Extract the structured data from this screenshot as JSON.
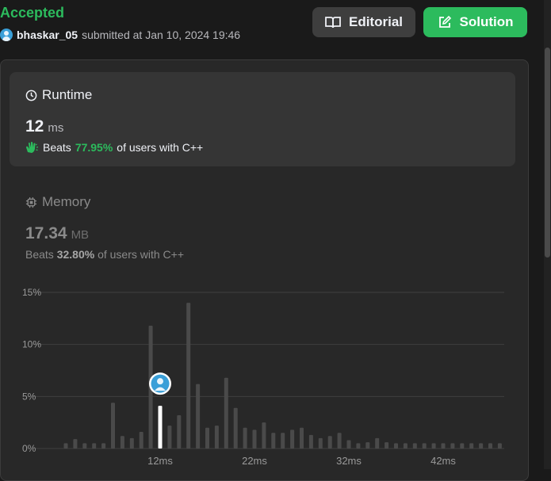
{
  "status": "Accepted",
  "submission": {
    "username": "bhaskar_05",
    "text": "submitted at Jan 10, 2024 19:46"
  },
  "buttons": {
    "editorial": "Editorial",
    "solution": "Solution"
  },
  "runtime": {
    "title": "Runtime",
    "value": "12",
    "unit": "ms",
    "beats_label": "Beats",
    "beats_percent": "77.95%",
    "beats_suffix": "of users with C++"
  },
  "memory": {
    "title": "Memory",
    "value": "17.34",
    "unit": "MB",
    "beats_label": "Beats",
    "beats_percent": "32.80%",
    "beats_suffix": "of users with C++"
  },
  "colors": {
    "accepted": "#2cbb5d",
    "bar": "#4a4a4a",
    "highlight": "#ffffff"
  },
  "icons": [
    "book-icon",
    "edit-icon",
    "clock-icon",
    "clap-icon",
    "chip-icon",
    "user-avatar-icon"
  ],
  "chart_data": {
    "type": "bar",
    "ylim": [
      0,
      15
    ],
    "y_ticks": [
      "15%",
      "10%",
      "5%",
      "0%"
    ],
    "x_ticks": [
      "12ms",
      "22ms",
      "32ms",
      "42ms"
    ],
    "x": [
      2,
      3,
      4,
      5,
      6,
      7,
      8,
      9,
      10,
      11,
      12,
      13,
      14,
      15,
      16,
      17,
      18,
      19,
      20,
      21,
      22,
      23,
      24,
      25,
      26,
      27,
      28,
      29,
      30,
      31,
      32,
      33,
      34,
      35,
      36,
      37,
      38,
      39,
      40,
      41,
      42,
      43,
      44,
      45,
      46,
      47,
      48
    ],
    "values": [
      0.5,
      0.9,
      0.5,
      0.5,
      0.5,
      4.4,
      1.2,
      1.0,
      1.6,
      11.8,
      4.1,
      2.2,
      3.2,
      14.0,
      6.2,
      2.0,
      2.2,
      6.8,
      3.9,
      2.0,
      1.8,
      2.5,
      1.5,
      1.5,
      1.8,
      2.0,
      1.3,
      1.0,
      1.2,
      1.5,
      0.8,
      0.5,
      0.6,
      1.0,
      0.6,
      0.5,
      0.5,
      0.5,
      0.5,
      0.5,
      0.5,
      0.5,
      0.5,
      0.5,
      0.5,
      0.5,
      0.5
    ],
    "highlight_x": 12,
    "grid": true
  }
}
